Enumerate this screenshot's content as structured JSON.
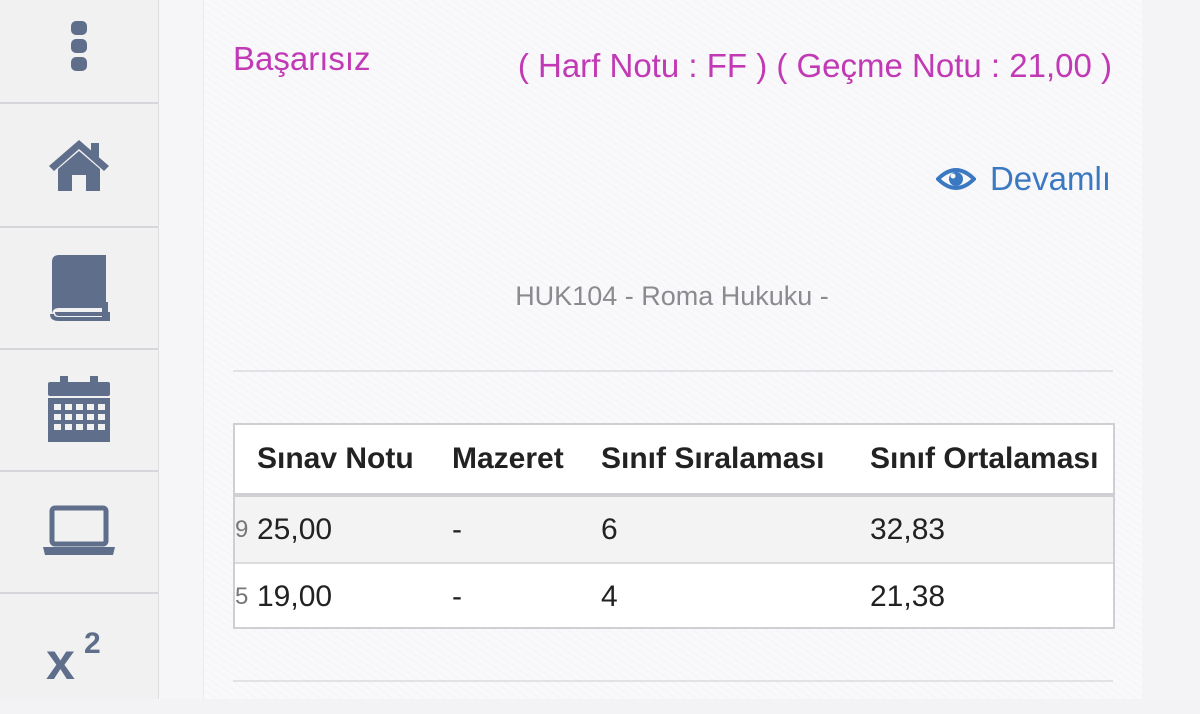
{
  "sidebar": {
    "items": [
      {
        "icon": "more-vertical-icon"
      },
      {
        "icon": "home-icon"
      },
      {
        "icon": "book-icon"
      },
      {
        "icon": "calendar-icon"
      },
      {
        "icon": "laptop-icon"
      },
      {
        "icon": "superscript-icon",
        "label": "x²"
      }
    ],
    "icon_color": "#5f6e8a"
  },
  "exam": {
    "status": "Başarısız",
    "grade_info": "( Harf Notu : FF ) ( Geçme Notu : 21,00 )",
    "attendance_label": "Devamlı",
    "status_color": "#c139b4",
    "attendance_color": "#3a78c2"
  },
  "course": {
    "title": "HUK104 - Roma Hukuku -"
  },
  "table": {
    "headers": [
      "Sınav Notu",
      "Mazeret",
      "Sınıf Sıralaması",
      "Sınıf Ortalaması"
    ],
    "rows": [
      {
        "lead": "9",
        "cells": [
          "25,00",
          "-",
          "6",
          "32,83"
        ]
      },
      {
        "lead": "5",
        "cells": [
          "19,00",
          "-",
          "4",
          "21,38"
        ]
      }
    ]
  }
}
